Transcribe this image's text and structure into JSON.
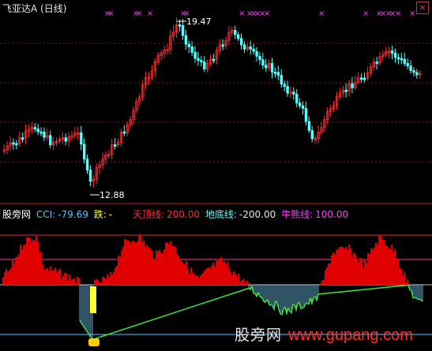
{
  "window": {
    "title": "飞亚达A (日线)",
    "close_label": "×"
  },
  "price_panel": {
    "high_label": "19.47",
    "low_label": "12.88",
    "up_color": "#ff3030",
    "down_color": "#54ffff",
    "signal_color": "#ff40ff",
    "signal_glyph": "×"
  },
  "indicator": {
    "name": "股旁网",
    "cci_label": "CCI:",
    "cci_value": "-79.69",
    "die_label": "跌:",
    "die_value": "-",
    "top_label": "天顶线:",
    "top_value": "200.00",
    "bottom_label": "地底线:",
    "bottom_value": "-200.00",
    "bull_label": "牛熊线:",
    "bull_value": "100.00",
    "bar_color": "#e00000",
    "line_color": "#40e040",
    "hatch_color": "#7ad4ff"
  },
  "watermark": {
    "cn": "股旁网",
    "en": "www.gupang.com"
  }
}
